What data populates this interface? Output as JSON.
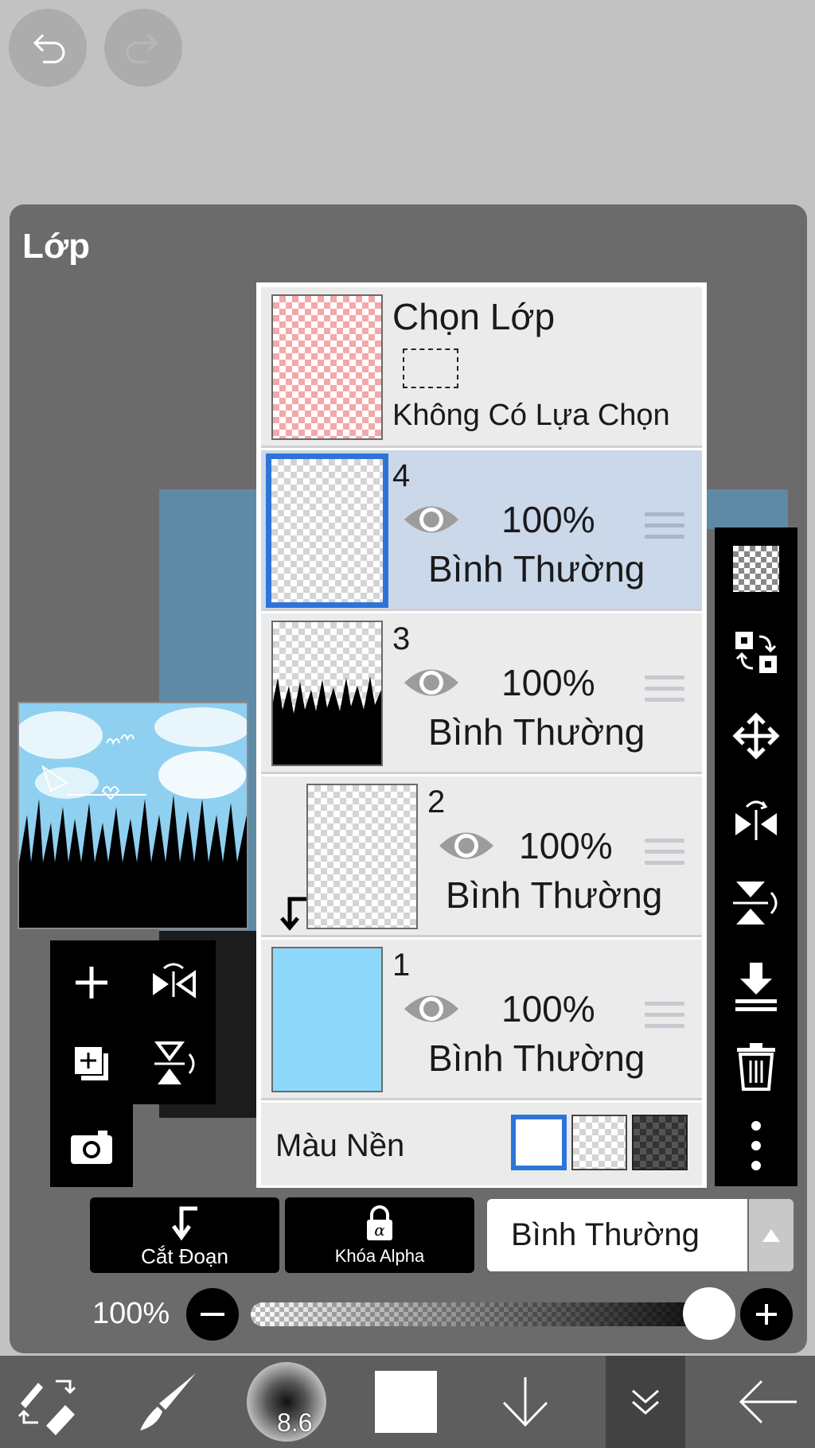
{
  "panel": {
    "title": "Lớp"
  },
  "selection_row": {
    "title": "Chọn Lớp",
    "status": "Không Có Lựa Chọn"
  },
  "layers": [
    {
      "number": "4",
      "opacity": "100%",
      "blend": "Bình Thường",
      "selected": true
    },
    {
      "number": "3",
      "opacity": "100%",
      "blend": "Bình Thường",
      "selected": false
    },
    {
      "number": "2",
      "opacity": "100%",
      "blend": "Bình Thường",
      "selected": false,
      "clipped": true
    },
    {
      "number": "1",
      "opacity": "100%",
      "blend": "Bình Thường",
      "selected": false
    }
  ],
  "background_color": {
    "label": "Màu Nền"
  },
  "actions": {
    "clipping_label": "Cắt Đoạn",
    "alpha_lock_label": "Khóa Alpha",
    "blend_mode_value": "Bình Thường"
  },
  "opacity_slider": {
    "label": "100%",
    "value": 1.0
  },
  "bottom_toolbar": {
    "brush_size_label": "8.6"
  },
  "colors": {
    "accent": "#2d74d9",
    "selected_row": "#cbd8ea",
    "layer1_fill": "#8ed9fb"
  }
}
